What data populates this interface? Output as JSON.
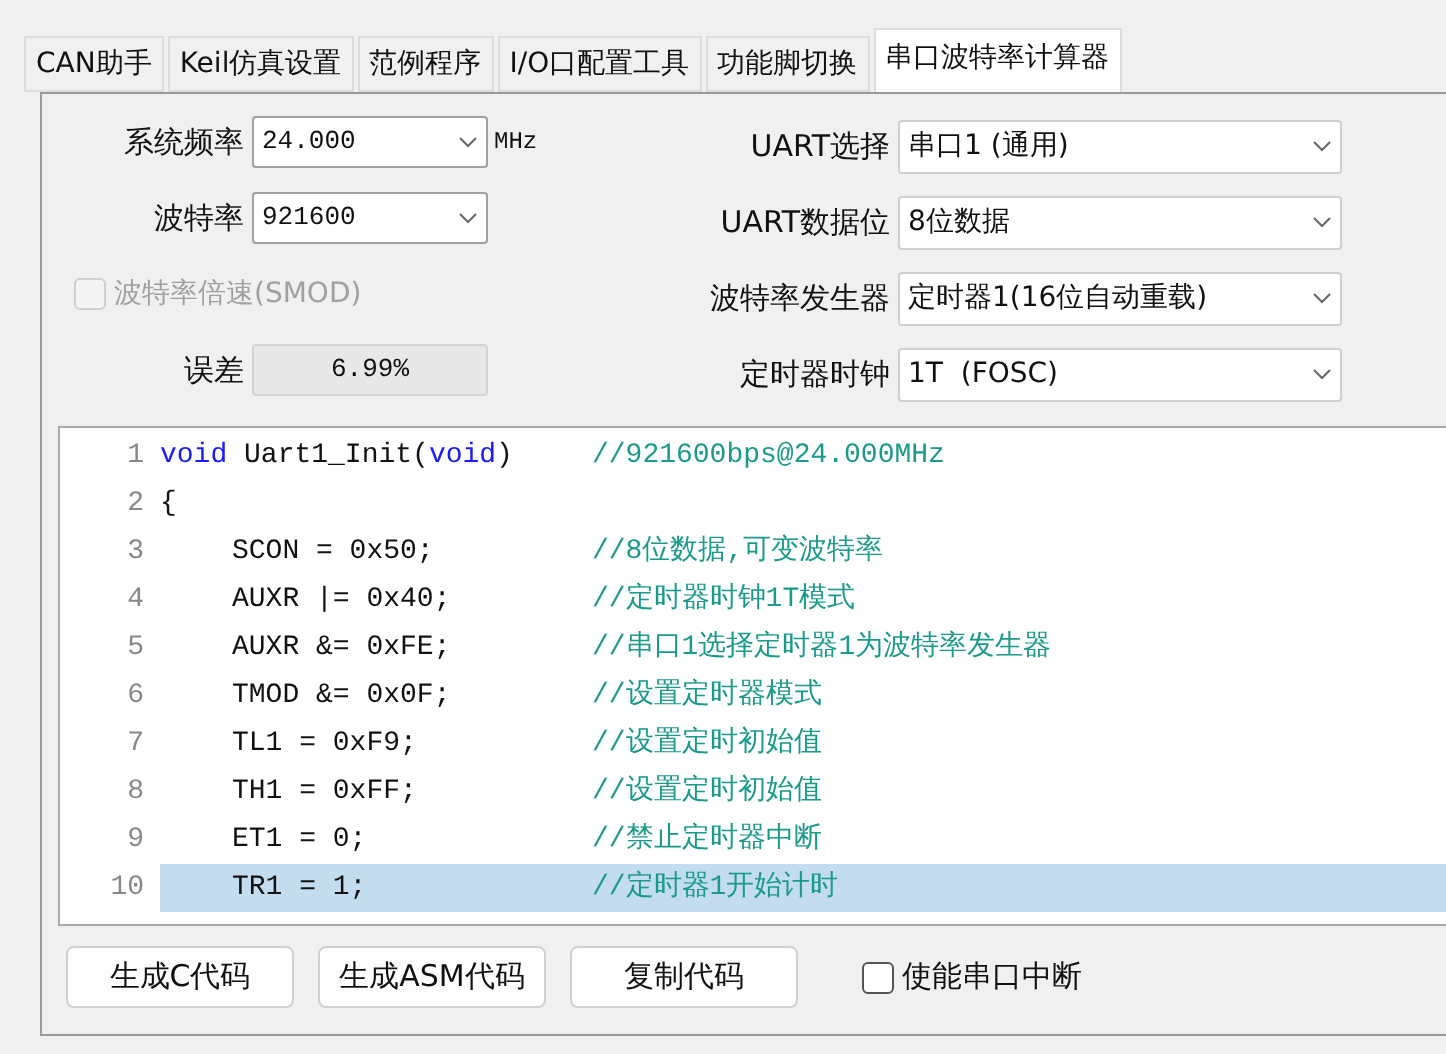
{
  "tabs": [
    {
      "label": "CAN助手",
      "selected": false
    },
    {
      "label": "Keil仿真设置",
      "selected": false
    },
    {
      "label": "范例程序",
      "selected": false
    },
    {
      "label": "I/O口配置工具",
      "selected": false
    },
    {
      "label": "功能脚切换",
      "selected": false
    },
    {
      "label": "串口波特率计算器",
      "selected": true
    }
  ],
  "left_fields": [
    {
      "kind": "combo",
      "label": "系统频率",
      "value": "24.000",
      "unit": "MHz"
    },
    {
      "kind": "combo",
      "label": "波特率",
      "value": "921600"
    },
    {
      "kind": "checkbox",
      "label": "波特率倍速(SMOD)",
      "checked": false,
      "disabled": true
    },
    {
      "kind": "readout",
      "label": "误差",
      "value": "6.99%"
    }
  ],
  "right_fields": [
    {
      "label": "UART选择",
      "value": "串口1 (通用)"
    },
    {
      "label": "UART数据位",
      "value": "8位数据"
    },
    {
      "label": "波特率发生器",
      "value": "定时器1(16位自动重载)"
    },
    {
      "label": "定时器时钟",
      "value": "1T  (FOSC)"
    }
  ],
  "code_lines": [
    {
      "number": "1",
      "indented": false,
      "selected": false,
      "parts": [
        {
          "text": "void",
          "kind": "keyword"
        },
        {
          "text": " Uart1_Init(",
          "kind": "plain"
        },
        {
          "text": "void",
          "kind": "keyword"
        },
        {
          "text": ")",
          "kind": "plain"
        }
      ],
      "comment": "//921600bps@24.000MHz"
    },
    {
      "number": "2",
      "indented": false,
      "selected": false,
      "parts": [
        {
          "text": "{",
          "kind": "plain"
        }
      ]
    },
    {
      "number": "3",
      "indented": true,
      "selected": false,
      "parts": [
        {
          "text": "SCON = 0x50;",
          "kind": "plain"
        }
      ],
      "comment": "//8位数据,可变波特率"
    },
    {
      "number": "4",
      "indented": true,
      "selected": false,
      "parts": [
        {
          "text": "AUXR |= 0x40;",
          "kind": "plain"
        }
      ],
      "comment": "//定时器时钟1T模式"
    },
    {
      "number": "5",
      "indented": true,
      "selected": false,
      "parts": [
        {
          "text": "AUXR &= 0xFE;",
          "kind": "plain"
        }
      ],
      "comment": "//串口1选择定时器1为波特率发生器"
    },
    {
      "number": "6",
      "indented": true,
      "selected": false,
      "parts": [
        {
          "text": "TMOD &= 0x0F;",
          "kind": "plain"
        }
      ],
      "comment": "//设置定时器模式"
    },
    {
      "number": "7",
      "indented": true,
      "selected": false,
      "parts": [
        {
          "text": "TL1 = 0xF9;",
          "kind": "plain"
        }
      ],
      "comment": "//设置定时初始值"
    },
    {
      "number": "8",
      "indented": true,
      "selected": false,
      "parts": [
        {
          "text": "TH1 = 0xFF;",
          "kind": "plain"
        }
      ],
      "comment": "//设置定时初始值"
    },
    {
      "number": "9",
      "indented": true,
      "selected": false,
      "parts": [
        {
          "text": "ET1 = 0;",
          "kind": "plain"
        }
      ],
      "comment": "//禁止定时器中断"
    },
    {
      "number": "10",
      "indented": true,
      "selected": true,
      "parts": [
        {
          "text": "TR1 = 1;",
          "kind": "plain"
        }
      ],
      "comment": "//定时器1开始计时"
    }
  ],
  "buttons": [
    "生成C代码",
    "生成ASM代码",
    "复制代码"
  ],
  "interrupt_checkbox": {
    "label": "使能串口中断",
    "checked": false
  }
}
